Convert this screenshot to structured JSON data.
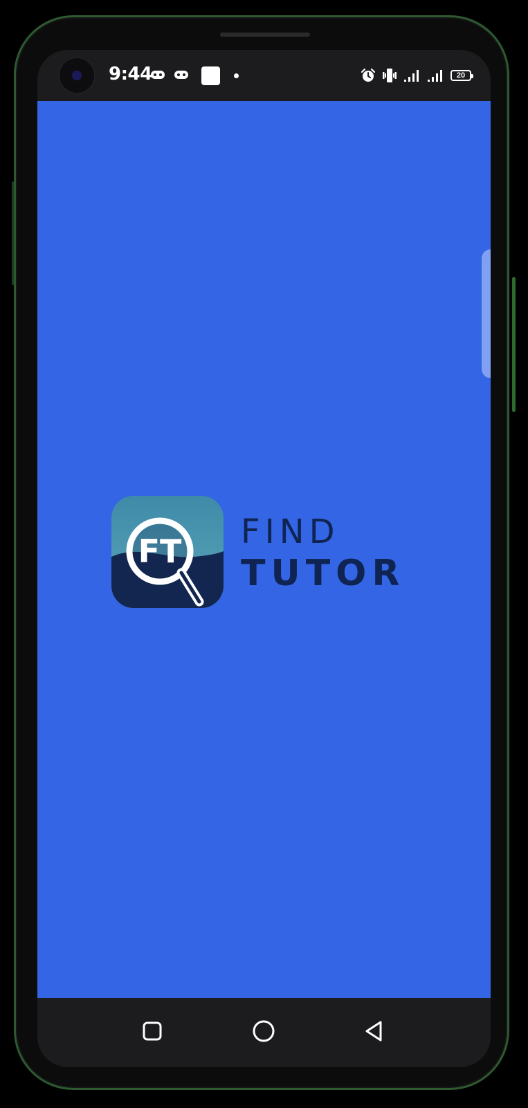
{
  "status_bar": {
    "time": "9:44",
    "battery_level": "20",
    "icons": [
      "gamepad-icon",
      "gamepad-icon",
      "app-notification-icon",
      "notification-dot-icon",
      "alarm-icon",
      "vibrate-icon",
      "signal-icon",
      "signal-icon",
      "battery-icon"
    ]
  },
  "splash": {
    "logo_letters": "FT",
    "brand_line1": "FIND",
    "brand_line2": "TUTOR",
    "background_color": "#3365e4",
    "brand_text_color": "#0f2452"
  },
  "nav_bar": {
    "buttons": [
      "recents-button",
      "home-button",
      "back-button"
    ]
  }
}
